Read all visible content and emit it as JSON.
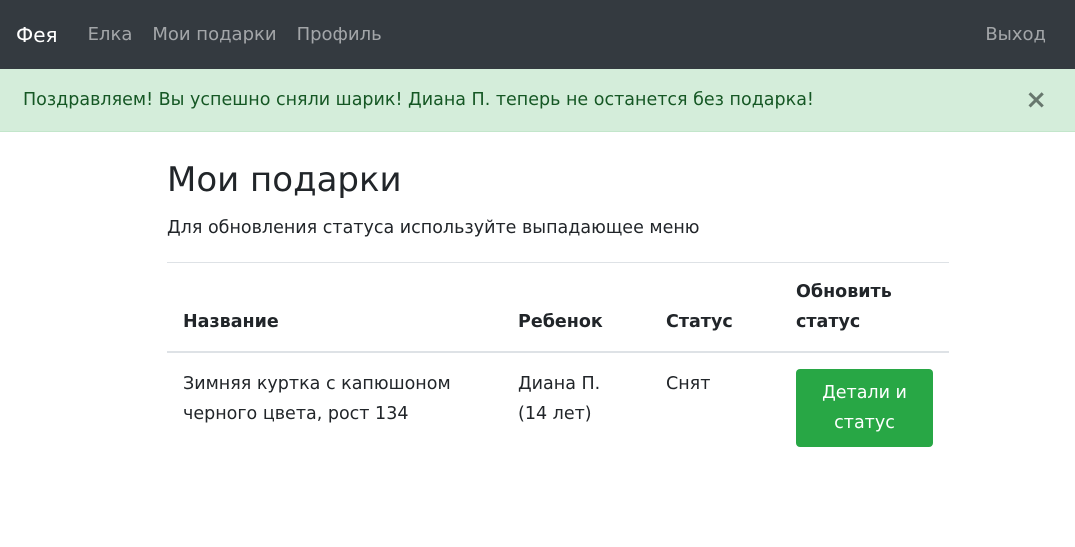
{
  "navbar": {
    "brand": "Фея",
    "links": [
      "Елка",
      "Мои подарки",
      "Профиль"
    ],
    "logout": "Выход",
    "background": "#343a40"
  },
  "alert": {
    "message": "Поздравляем! Вы успешно сняли шарик! Диана П. теперь не останется без подарка!",
    "close_symbol": "×",
    "background": "#d4edda",
    "text_color": "#155724"
  },
  "main": {
    "title": "Мои подарки",
    "subtitle": "Для обновления статуса используйте выпадающее меню"
  },
  "table": {
    "headers": {
      "name": "Название",
      "child": "Ребенок",
      "status": "Статус",
      "update": "Обновить статус"
    },
    "rows": [
      {
        "name": "Зимняя куртка с капюшоном черного цвета, рост 134",
        "child": "Диана П. (14 лет)",
        "status": "Снят",
        "button": "Детали и статус"
      }
    ]
  },
  "colors": {
    "success": "#28a745"
  }
}
